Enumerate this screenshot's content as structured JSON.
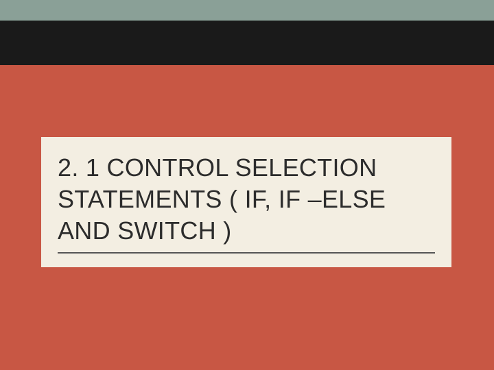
{
  "slide": {
    "title": "2. 1 CONTROL SELECTION STATEMENTS ( IF, IF –ELSE AND SWITCH )"
  },
  "colors": {
    "background": "#c85744",
    "top_bar": "#8aa097",
    "black_bar": "#1a1a1a",
    "title_box": "#f3eee2",
    "title_text": "#2c2c2c"
  }
}
